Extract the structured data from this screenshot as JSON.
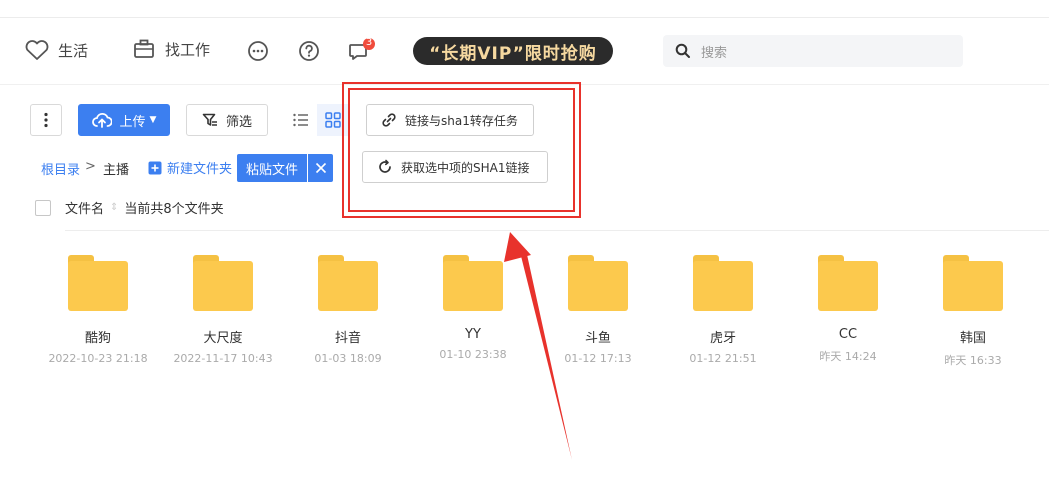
{
  "nav": {
    "life": "生活",
    "job": "找工作",
    "badge": "3",
    "vip": "“长期VIP”限时抢购",
    "search_placeholder": "搜索"
  },
  "toolbar": {
    "upload": "上传",
    "filter": "筛选"
  },
  "popup": {
    "link_transfer": "链接与sha1转存任务",
    "get_sha1": "获取选中项的SHA1链接"
  },
  "breadcrumb": {
    "root": "根目录",
    "separator": ">",
    "current": "主播",
    "new_folder": "新建文件夹",
    "paste": "粘贴文件"
  },
  "list_header": {
    "name_col": "文件名",
    "summary": "当前共8个文件夹"
  },
  "folders": [
    {
      "name": "酷狗",
      "date": "2022-10-23 21:18"
    },
    {
      "name": "大尺度",
      "date": "2022-11-17 10:43"
    },
    {
      "name": "抖音",
      "date": "01-03 18:09"
    },
    {
      "name": "YY",
      "date": "01-10 23:38"
    },
    {
      "name": "斗鱼",
      "date": "01-12 17:13"
    },
    {
      "name": "虎牙",
      "date": "01-12 21:51"
    },
    {
      "name": "CC",
      "date": "昨天 14:24"
    },
    {
      "name": "韩国",
      "date": "昨天 16:33"
    }
  ],
  "colors": {
    "primary": "#3c7ff0",
    "annotation": "#e8322c",
    "folder": "#fcc94d"
  }
}
